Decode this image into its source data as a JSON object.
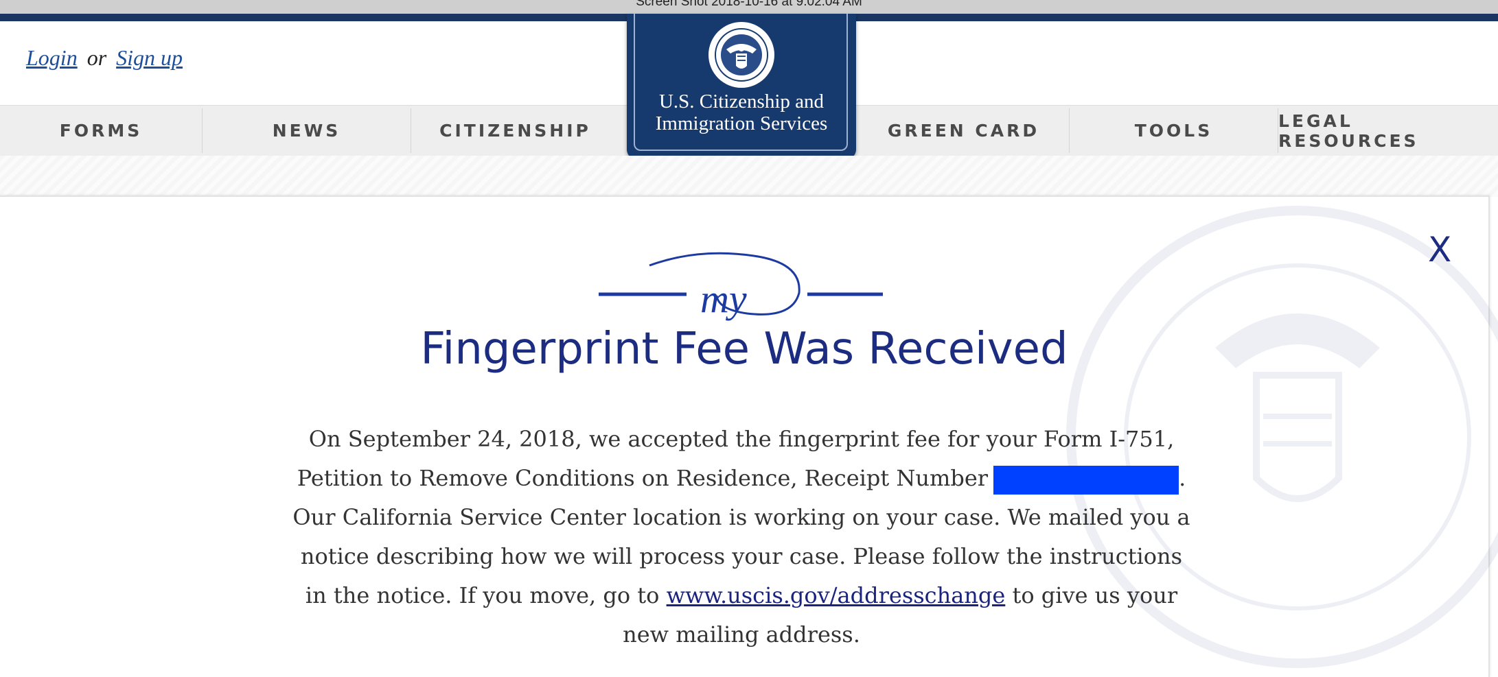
{
  "window": {
    "title": "Screen Shot 2018-10-16 at 9.02.04 AM"
  },
  "auth": {
    "login_label": "Login",
    "or_text": "or",
    "signup_label": "Sign up"
  },
  "logo": {
    "line1": "U.S. Citizenship and",
    "line2": "Immigration Services"
  },
  "nav": {
    "items": [
      {
        "label": "FORMS"
      },
      {
        "label": "NEWS"
      },
      {
        "label": "CITIZENSHIP"
      },
      {
        "label": "GREEN CARD"
      },
      {
        "label": "TOOLS"
      },
      {
        "label": "LEGAL RESOURCES"
      }
    ]
  },
  "case_status": {
    "close_label": "X",
    "brand_mark": "my",
    "title": "Fingerprint Fee Was Received",
    "body_part1": "On September 24, 2018, we accepted the fingerprint fee for your Form I-751, Petition to Remove Conditions on Residence, Receipt Number",
    "body_part2": ". Our California Service Center location is working on your case. We mailed you a notice describing how we will process your case. Please follow the instructions in the notice. If you move, go to",
    "link_text": "www.uscis.gov/addresschange",
    "body_part3": "to give us your new mailing address."
  },
  "colors": {
    "navy": "#173a6e",
    "title_blue": "#1c2c80",
    "redaction": "#0040ff"
  }
}
